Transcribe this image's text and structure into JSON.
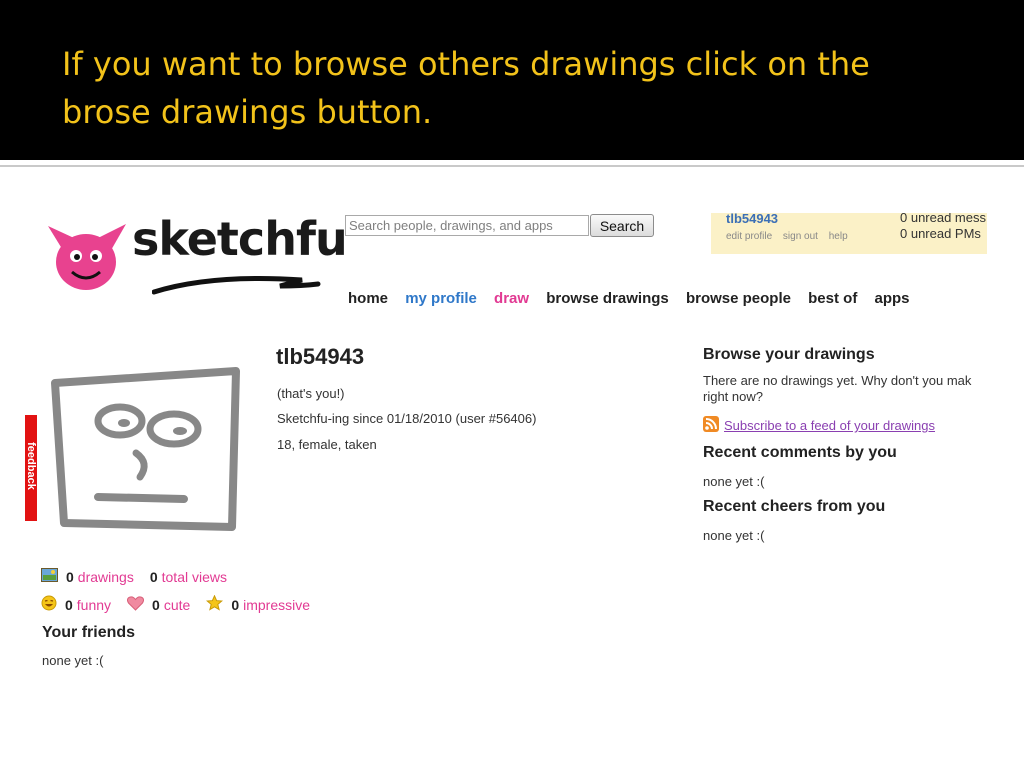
{
  "slide": {
    "title": "If you want to browse others drawings click on the brose drawings button."
  },
  "site": {
    "logo_text": "sketchfu",
    "brand_pink": "#e8428f",
    "link_pink": "#e23a93",
    "link_blue": "#2f78c9"
  },
  "search": {
    "placeholder": "Search people, drawings, and apps",
    "button_label": "Search"
  },
  "user_box": {
    "username": "tlb54943",
    "links": [
      "edit profile",
      "sign out",
      "help"
    ],
    "messages": [
      "0 unread mess",
      "0 unread PMs"
    ]
  },
  "nav": {
    "items": [
      "home",
      "my profile",
      "draw",
      "browse drawings",
      "browse people",
      "best of",
      "apps"
    ]
  },
  "feedback_tab": {
    "label": "feedback"
  },
  "profile": {
    "username": "tlb54943",
    "thats_you": "(that's you!)",
    "since": "Sketchfu-ing since 01/18/2010 (user #56406)",
    "details": "18, female, taken"
  },
  "stats": {
    "drawings_count": "0",
    "drawings_label": "drawings",
    "views_count": "0",
    "views_label": "total views",
    "funny_count": "0",
    "funny_label": "funny",
    "cute_count": "0",
    "cute_label": "cute",
    "impressive_count": "0",
    "impressive_label": "impressive"
  },
  "friends": {
    "title": "Your friends",
    "empty": "none yet :("
  },
  "right_column": {
    "browse_title": "Browse your drawings",
    "browse_text": "There are no drawings yet. Why don't you mak right now?",
    "subscribe_link": "Subscribe to a feed of your drawings",
    "comments_title": "Recent comments by you",
    "comments_empty": "none yet :(",
    "cheers_title": "Recent cheers from you",
    "cheers_empty": "none yet :("
  }
}
